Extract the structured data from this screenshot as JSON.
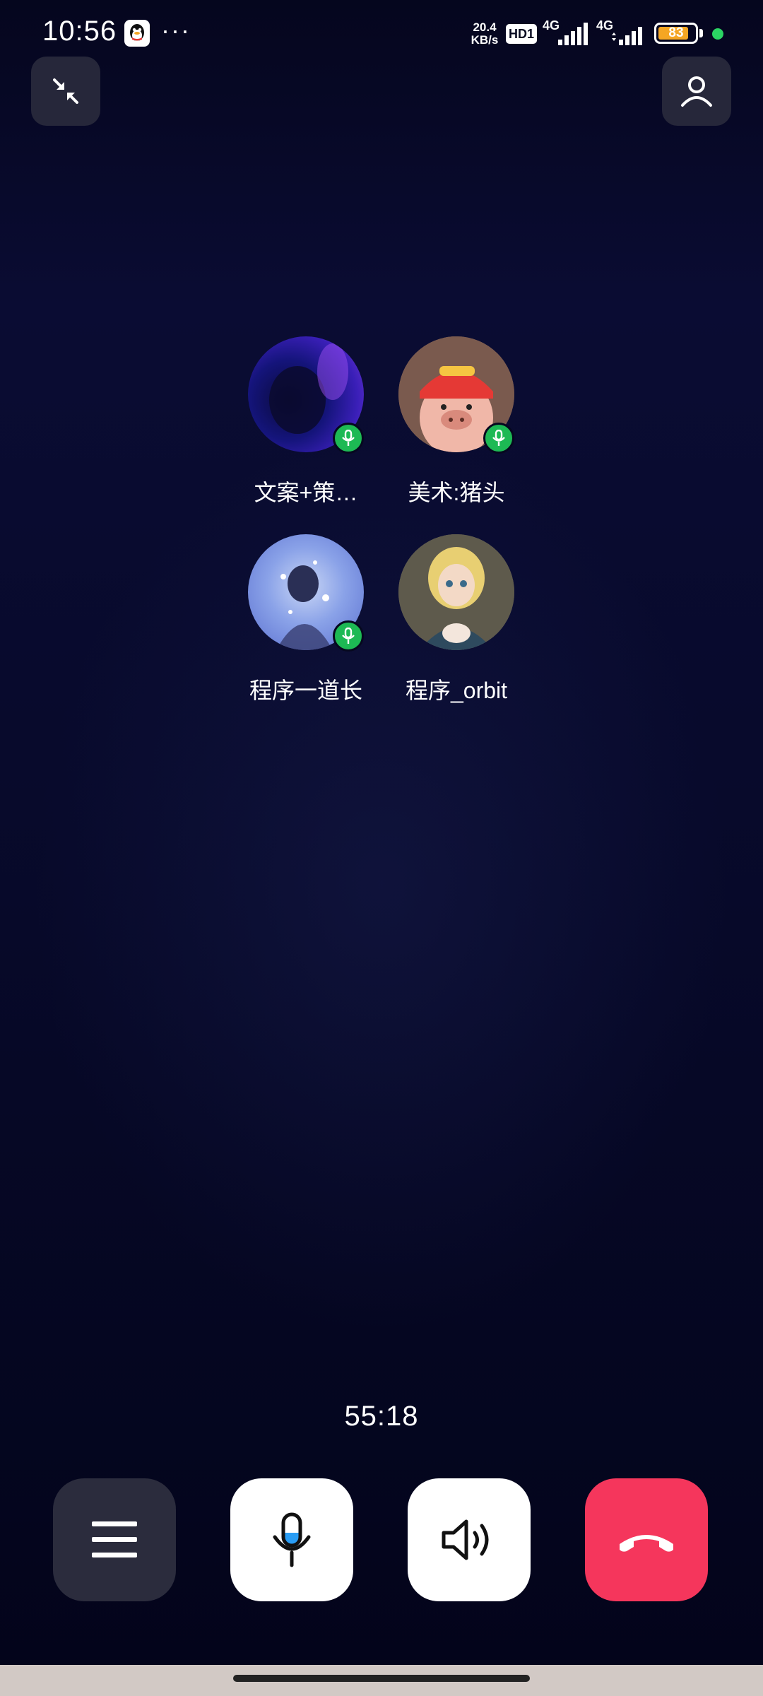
{
  "status_bar": {
    "time": "10:56",
    "more_glyph": "···",
    "net_speed_value": "20.4",
    "net_speed_unit": "KB/s",
    "hd_label": "HD1",
    "net1": "4G",
    "net2": "4G",
    "battery_percent": 83,
    "battery_label": "83",
    "battery_color": "#f5a623",
    "active_dot_color": "#2bd463"
  },
  "top_buttons": {
    "minimize_icon": "minimize-icon",
    "add_member_icon": "person-icon"
  },
  "participants": [
    {
      "name": "文案+策…",
      "mic_active": true
    },
    {
      "name": "美术:猪头",
      "mic_active": true
    },
    {
      "name": "程序一道长",
      "mic_active": true
    },
    {
      "name": "程序_orbit",
      "mic_active": false
    }
  ],
  "call": {
    "duration": "55:18"
  },
  "controls": {
    "menu_icon": "menu-icon",
    "mic_icon": "microphone-icon",
    "speaker_icon": "speaker-icon",
    "hangup_icon": "hang-up-icon",
    "hangup_color": "#f5365c",
    "mic_badge_color": "#1db954"
  }
}
